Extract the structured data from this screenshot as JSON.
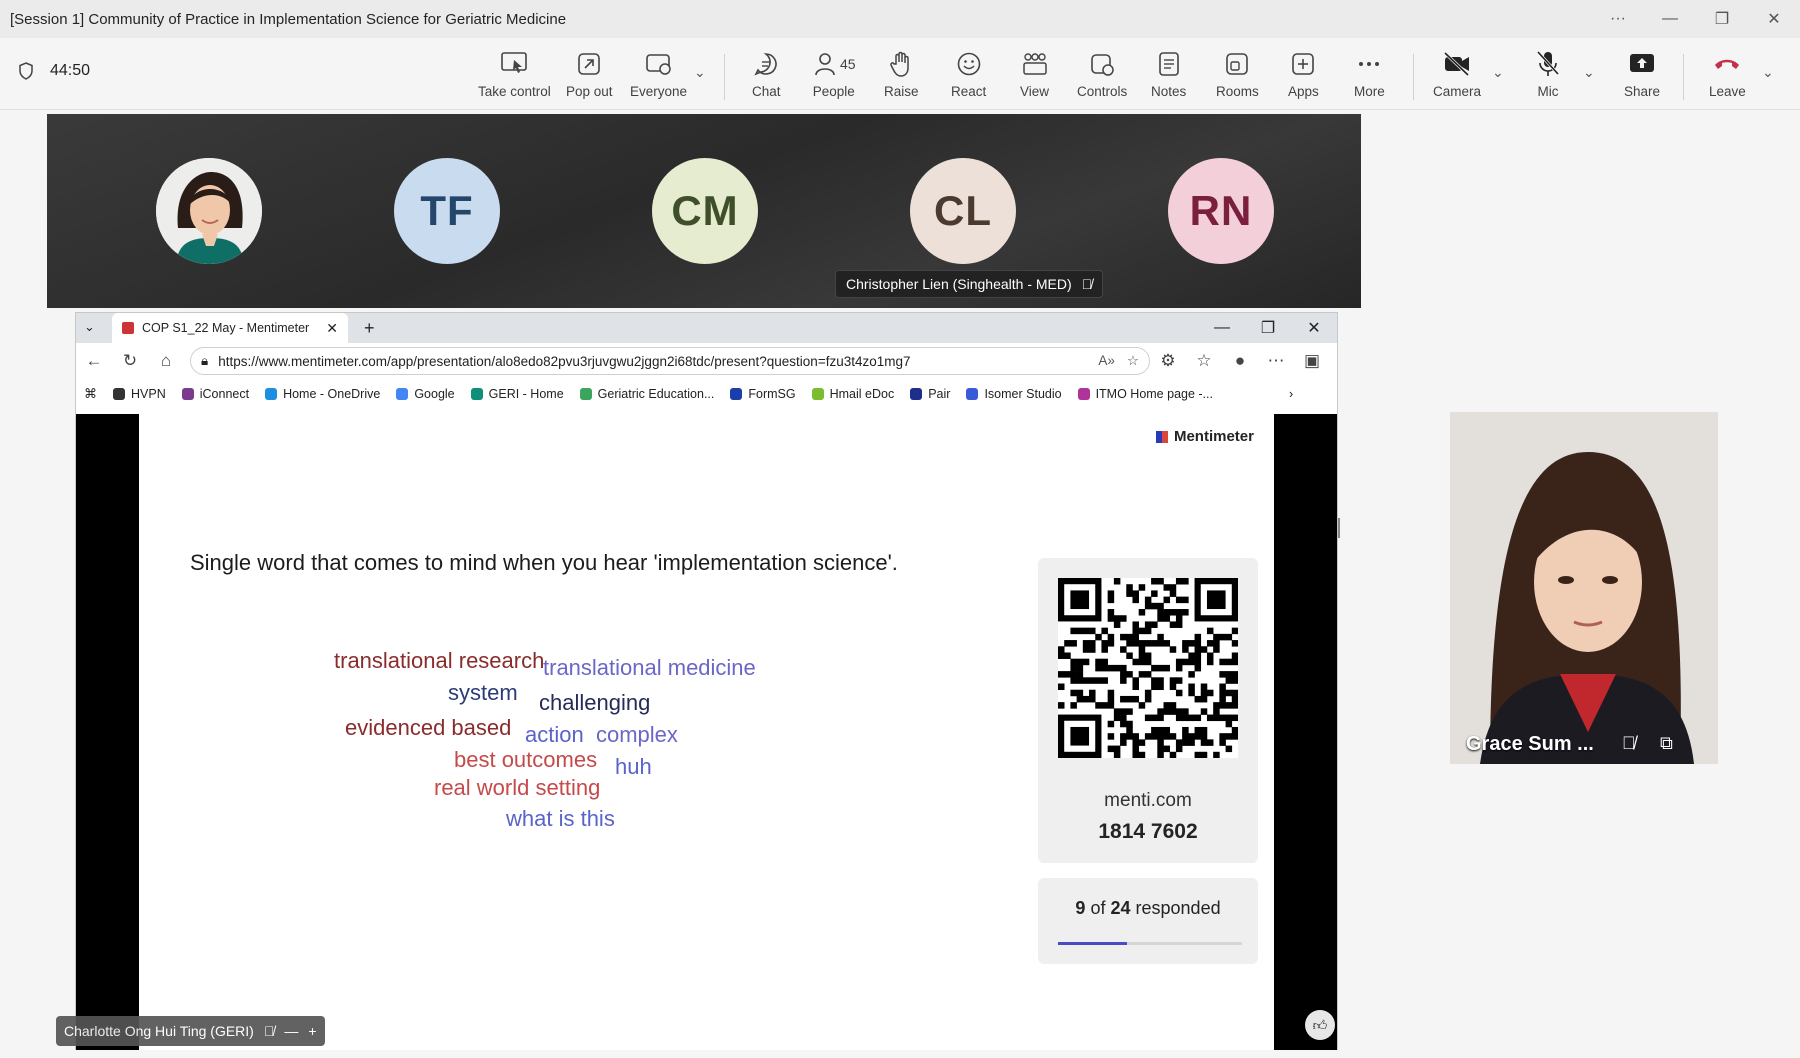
{
  "window": {
    "title": "[Session 1] Community of Practice in Implementation Science for Geriatric Medicine",
    "controls": [
      "···",
      "—",
      "❐",
      "✕"
    ]
  },
  "meeting": {
    "timer": "44:50",
    "toolbar": [
      {
        "id": "take-control",
        "label": "Take control",
        "icon": "take-control-icon"
      },
      {
        "id": "pop-out",
        "label": "Pop out",
        "icon": "pop-out-icon"
      },
      {
        "id": "everyone",
        "label": "Everyone",
        "icon": "everyone-icon"
      },
      {
        "id": "chat",
        "label": "Chat",
        "icon": "chat-icon"
      },
      {
        "id": "people",
        "label": "People",
        "icon": "people-icon",
        "count": "45"
      },
      {
        "id": "raise",
        "label": "Raise",
        "icon": "raise-hand-icon"
      },
      {
        "id": "react",
        "label": "React",
        "icon": "react-icon"
      },
      {
        "id": "view",
        "label": "View",
        "icon": "view-icon"
      },
      {
        "id": "controls",
        "label": "Controls",
        "icon": "controls-icon"
      },
      {
        "id": "notes",
        "label": "Notes",
        "icon": "notes-icon"
      },
      {
        "id": "rooms",
        "label": "Rooms",
        "icon": "rooms-icon"
      },
      {
        "id": "apps",
        "label": "Apps",
        "icon": "apps-icon"
      },
      {
        "id": "more",
        "label": "More",
        "icon": "more-icon"
      },
      {
        "id": "camera",
        "label": "Camera",
        "icon": "camera-off-icon"
      },
      {
        "id": "mic",
        "label": "Mic",
        "icon": "mic-off-icon"
      },
      {
        "id": "share",
        "label": "Share",
        "icon": "share-icon"
      },
      {
        "id": "leave",
        "label": "Leave",
        "icon": "leave-call-icon"
      }
    ]
  },
  "participants": [
    {
      "initials": "",
      "photo": true,
      "bg": "#e8e6e2"
    },
    {
      "initials": "TF",
      "bg": "#c9dbef",
      "fg": "#24466b"
    },
    {
      "initials": "CM",
      "bg": "#e6ecd0",
      "fg": "#3f4f2a"
    },
    {
      "initials": "CL",
      "bg": "#ece0d8",
      "fg": "#4a3a30"
    },
    {
      "initials": "RN",
      "bg": "#f3cfd9",
      "fg": "#7a1f3d"
    }
  ],
  "active_speaker_tag": "Christopher Lien (Singhealth - MED)",
  "browser": {
    "tab_title": "COP S1_22 May - Mentimeter",
    "url": "https://www.mentimeter.com/app/presentation/alo8edo82pvu3rjuvgwu2jggn2i68tdc/present?question=fzu3t4zo1mg7",
    "bookmarks": [
      {
        "label": "HVPN",
        "color": "#333333"
      },
      {
        "label": "iConnect",
        "color": "#7a3b8f"
      },
      {
        "label": "Home - OneDrive",
        "color": "#1e8fe0"
      },
      {
        "label": "Google",
        "color": "#4285f4"
      },
      {
        "label": "GERI - Home",
        "color": "#0f8f7a"
      },
      {
        "label": "Geriatric Education...",
        "color": "#3aa55d"
      },
      {
        "label": "FormSG",
        "color": "#1b3ea8"
      },
      {
        "label": "Hmail eDoc",
        "color": "#7cbd2d"
      },
      {
        "label": "Pair",
        "color": "#1d2f8a"
      },
      {
        "label": "Isomer Studio",
        "color": "#3a5bd9"
      },
      {
        "label": "ITMO Home page -...",
        "color": "#b0339c"
      }
    ]
  },
  "slide": {
    "brand": "Mentimeter",
    "question": "Single word that comes to mind when you hear 'implementation science'.",
    "word_cloud": [
      {
        "text": "translational research",
        "color": "#8b2c2c",
        "size": 22
      },
      {
        "text": "translational medicine",
        "color": "#6a67c9",
        "size": 22
      },
      {
        "text": "system",
        "color": "#2d3b7a",
        "size": 22
      },
      {
        "text": "challenging",
        "color": "#252c59",
        "size": 22
      },
      {
        "text": "evidenced based",
        "color": "#8b2c2c",
        "size": 22
      },
      {
        "text": "action",
        "color": "#5a63c9",
        "size": 22
      },
      {
        "text": "complex",
        "color": "#6a67c9",
        "size": 22
      },
      {
        "text": "best outcomes",
        "color": "#c54a4a",
        "size": 22
      },
      {
        "text": "huh",
        "color": "#5a63c9",
        "size": 22
      },
      {
        "text": "real world setting",
        "color": "#c54a4a",
        "size": 22
      },
      {
        "text": "what is this",
        "color": "#5a63c9",
        "size": 22
      }
    ],
    "join_site": "menti.com",
    "join_code": "1814 7602",
    "responded_count": "9",
    "responded_of": "of",
    "responded_total": "24",
    "responded_label": "responded",
    "responded_fraction": 0.375
  },
  "presenter_tag": "Charlotte Ong Hui Ting (GERI)",
  "speaker_video": {
    "name": "Grace Sum ..."
  }
}
